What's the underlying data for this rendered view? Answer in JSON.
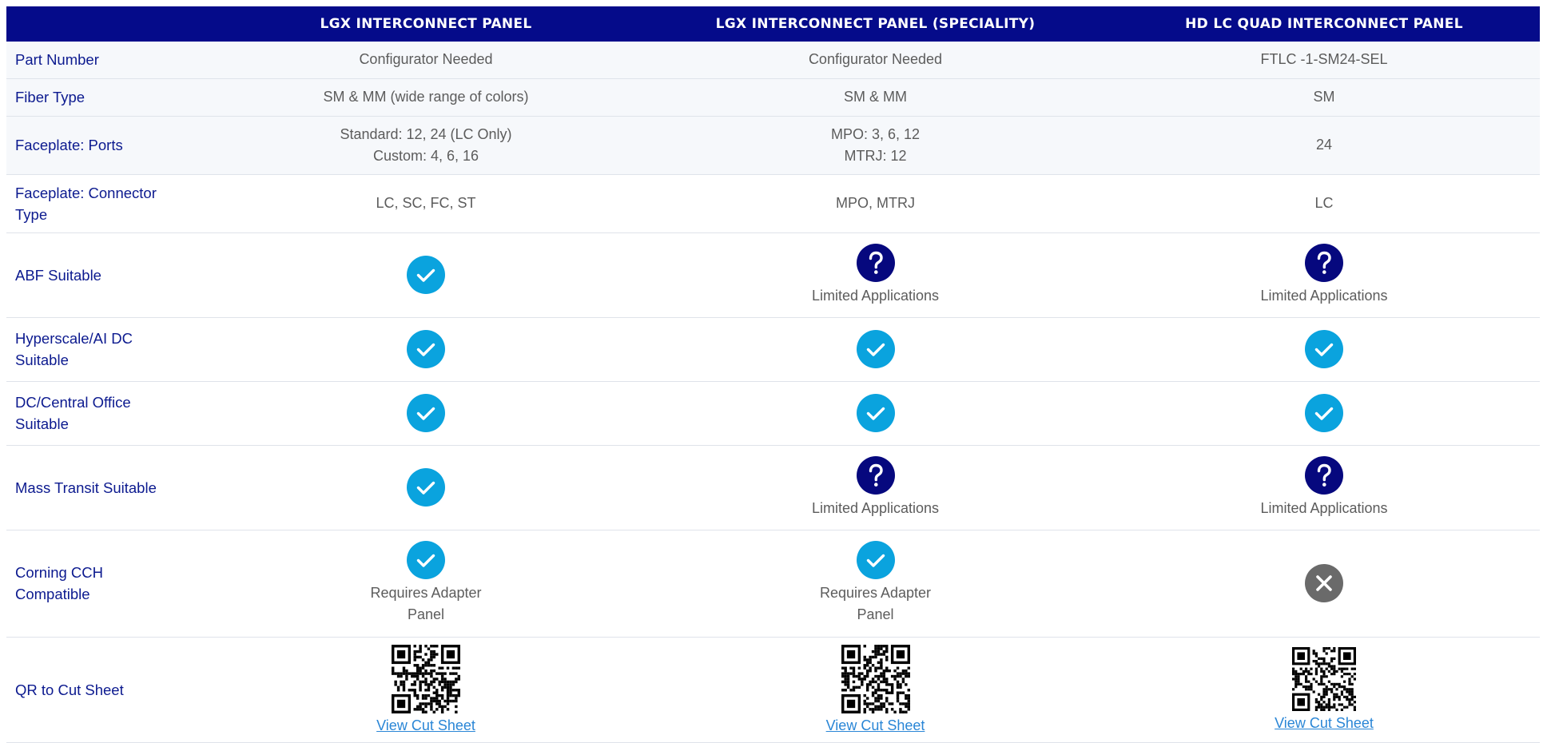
{
  "header": {
    "columns": [
      "",
      "LGX INTERCONNECT PANEL",
      "LGX INTERCONNECT PANEL (SPECIALITY)",
      "HD LC QUAD  INTERCONNECT PANEL"
    ]
  },
  "rows": [
    {
      "label": "Part Number",
      "cells": [
        {
          "type": "text",
          "lines": [
            "Configurator Needed"
          ]
        },
        {
          "type": "text",
          "lines": [
            "Configurator Needed"
          ]
        },
        {
          "type": "text",
          "lines": [
            "FTLC -1-SM24-SEL"
          ]
        }
      ]
    },
    {
      "label": "Fiber Type",
      "cells": [
        {
          "type": "text",
          "lines": [
            "SM & MM (wide range of colors)"
          ]
        },
        {
          "type": "text",
          "lines": [
            "SM & MM"
          ]
        },
        {
          "type": "text",
          "lines": [
            "SM"
          ]
        }
      ]
    },
    {
      "label": "Faceplate: Ports",
      "cells": [
        {
          "type": "text",
          "lines": [
            "Standard: 12, 24 (LC Only)",
            "Custom: 4, 6, 16"
          ]
        },
        {
          "type": "text",
          "lines": [
            "MPO: 3, 6, 12",
            "MTRJ: 12"
          ]
        },
        {
          "type": "text",
          "lines": [
            "24"
          ]
        }
      ]
    },
    {
      "label": "Faceplate: Connector Type",
      "cells": [
        {
          "type": "text",
          "lines": [
            "LC, SC, FC, ST"
          ]
        },
        {
          "type": "text",
          "lines": [
            "MPO, MTRJ"
          ]
        },
        {
          "type": "text",
          "lines": [
            "LC"
          ]
        }
      ]
    },
    {
      "label": "ABF Suitable",
      "cells": [
        {
          "type": "icon",
          "icon": "check-icon"
        },
        {
          "type": "icon",
          "icon": "question-icon",
          "note": "Limited Applications"
        },
        {
          "type": "icon",
          "icon": "question-icon",
          "note": "Limited Applications"
        }
      ]
    },
    {
      "label": "Hyperscale/AI DC Suitable",
      "cells": [
        {
          "type": "icon",
          "icon": "check-icon"
        },
        {
          "type": "icon",
          "icon": "check-icon"
        },
        {
          "type": "icon",
          "icon": "check-icon"
        }
      ]
    },
    {
      "label": "DC/Central Office Suitable",
      "cells": [
        {
          "type": "icon",
          "icon": "check-icon"
        },
        {
          "type": "icon",
          "icon": "check-icon"
        },
        {
          "type": "icon",
          "icon": "check-icon"
        }
      ]
    },
    {
      "label": "Mass Transit Suitable",
      "cells": [
        {
          "type": "icon",
          "icon": "check-icon"
        },
        {
          "type": "icon",
          "icon": "question-icon",
          "note": "Limited Applications"
        },
        {
          "type": "icon",
          "icon": "question-icon",
          "note": "Limited Applications"
        }
      ]
    },
    {
      "label": "Corning CCH Compatible",
      "cells": [
        {
          "type": "icon",
          "icon": "check-icon",
          "note": "Requires Adapter Panel"
        },
        {
          "type": "icon",
          "icon": "check-icon",
          "note": "Requires Adapter Panel"
        },
        {
          "type": "icon",
          "icon": "x-icon"
        }
      ]
    },
    {
      "label": "QR to Cut Sheet",
      "cells": [
        {
          "type": "qr",
          "link": "View Cut Sheet"
        },
        {
          "type": "qr",
          "link": "View Cut Sheet"
        },
        {
          "type": "qr",
          "link": "View Cut Sheet"
        }
      ]
    }
  ],
  "colors": {
    "header_bg": "#050b8a",
    "label_text": "#0c1a8f",
    "check": "#0aa3de",
    "question": "#06087e",
    "x": "#6a6a6a",
    "link": "#2a86d6"
  }
}
